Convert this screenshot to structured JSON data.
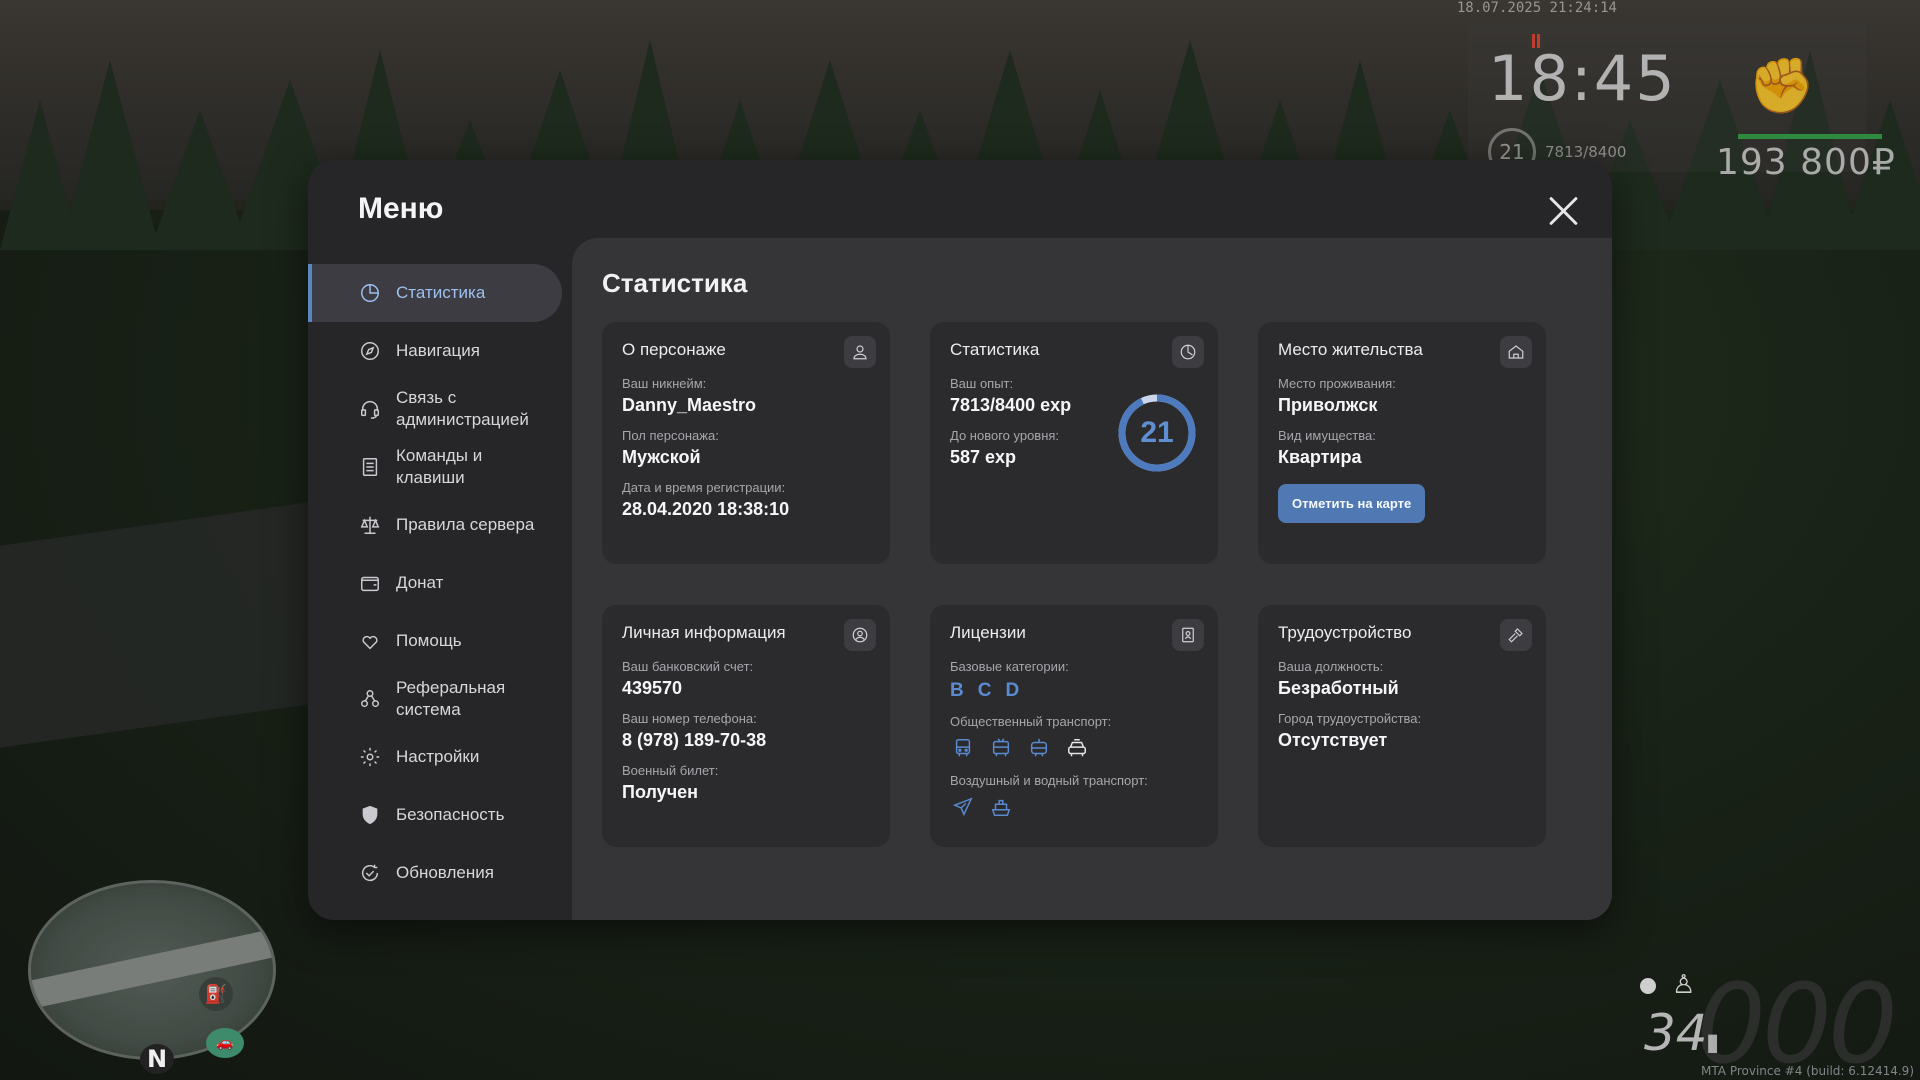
{
  "hud": {
    "timestamp": "18.07.2025 21:24:14",
    "clock": "18:45",
    "money": "193 800₽",
    "level": "21",
    "exp": "7813/8400",
    "speed_ghost": "000",
    "fuel": "34",
    "build": "MTA Province #4 (build: 6.12414.9)",
    "minimap_north": "N",
    "health_color": "#2e8a3e"
  },
  "menu": {
    "title": "Меню",
    "accent_color": "#5a86c2",
    "sidebar": [
      {
        "label": "Статистика",
        "icon": "pie-chart-icon",
        "active": true
      },
      {
        "label": "Навигация",
        "icon": "compass-icon"
      },
      {
        "label": "Связь с\nадминистрацией",
        "icon": "headset-icon"
      },
      {
        "label": "Команды и\nклавиши",
        "icon": "document-icon"
      },
      {
        "label": "Правила сервера",
        "icon": "scales-icon"
      },
      {
        "label": "Донат",
        "icon": "wallet-icon"
      },
      {
        "label": "Помощь",
        "icon": "heart-hand-icon"
      },
      {
        "label": "Реферальная\nсистема",
        "icon": "users-icon"
      },
      {
        "label": "Настройки",
        "icon": "gear-icon"
      },
      {
        "label": "Безопасность",
        "icon": "shield-icon"
      },
      {
        "label": "Обновления",
        "icon": "refresh-check-icon"
      }
    ]
  },
  "stats": {
    "title": "Статистика",
    "character": {
      "title": "О персонаже",
      "icon": "user-icon",
      "nickname_label": "Ваш никнейм:",
      "nickname": "Danny_Maestro",
      "gender_label": "Пол персонажа:",
      "gender": "Мужской",
      "reg_label": "Дата и время регистрации:",
      "reg": "28.04.2020 18:38:10"
    },
    "experience": {
      "title": "Статистика",
      "icon": "clock-pie-icon",
      "exp_label": "Ваш опыт:",
      "exp": "7813/8400 exp",
      "next_label": "До нового уровня:",
      "next": "587 exp",
      "level": "21",
      "progress": 0.93
    },
    "residence": {
      "title": "Место жительства",
      "icon": "house-icon",
      "place_label": "Место проживания:",
      "place": "Приволжск",
      "type_label": "Вид имущества:",
      "type": "Квартира",
      "button": "Отметить на карте"
    },
    "personal": {
      "title": "Личная информация",
      "icon": "user-circle-icon",
      "bank_label": "Ваш банковский счет:",
      "bank": "439570",
      "phone_label": "Ваш номер телефона:",
      "phone": "8 (978) 189-70-38",
      "military_label": "Военный билет:",
      "military": "Получен"
    },
    "licenses": {
      "title": "Лицензии",
      "icon": "id-card-icon",
      "base_label": "Базовые категории:",
      "categories": [
        "B",
        "C",
        "D"
      ],
      "public_label": "Общественный транспорт:",
      "public_icons": [
        "bus-icon",
        "trolleybus-icon",
        "tram-icon",
        "taxi-icon"
      ],
      "air_label": "Воздушный и водный транспорт:",
      "air_icons": [
        "airplane-icon",
        "boat-icon"
      ]
    },
    "employment": {
      "title": "Трудоустройство",
      "icon": "hammer-icon",
      "position_label": "Ваша должность:",
      "position": "Безработный",
      "city_label": "Город трудоустройства:",
      "city": "Отсутствует"
    }
  }
}
